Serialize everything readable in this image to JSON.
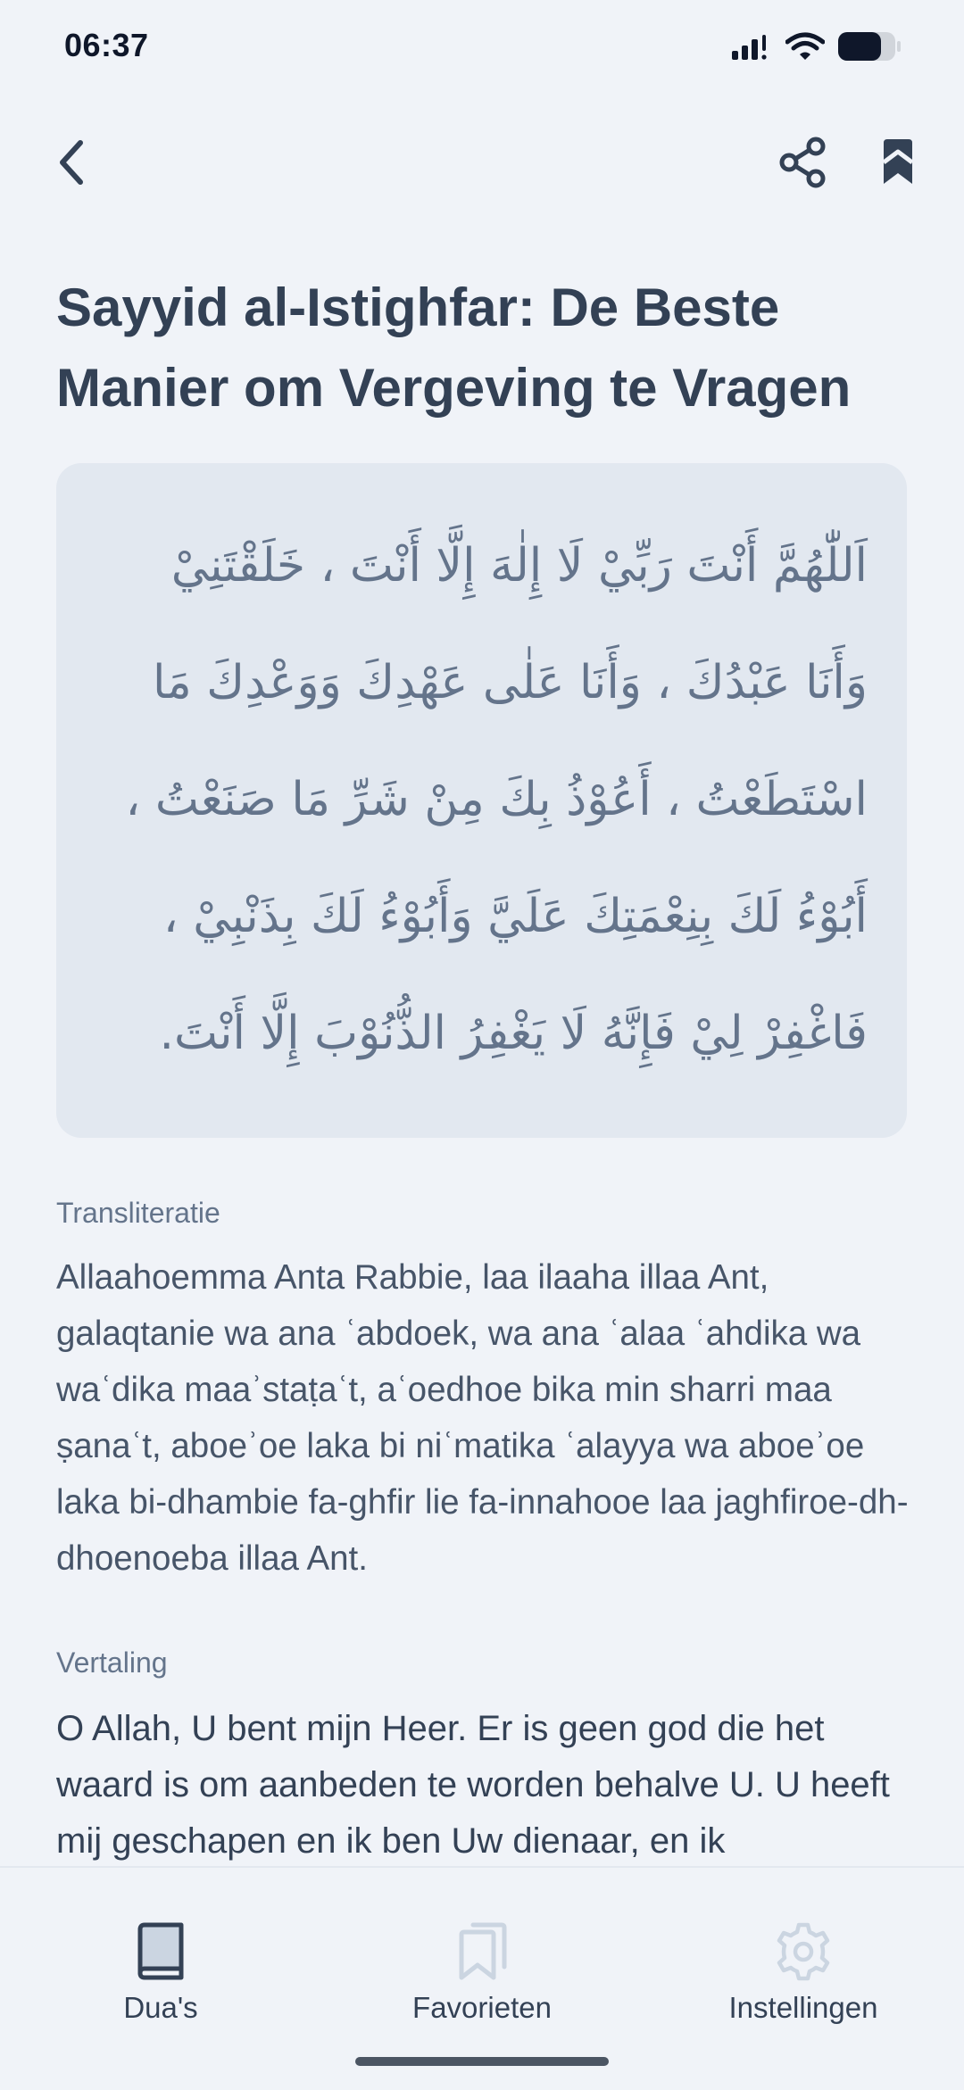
{
  "status_bar": {
    "time": "06:37"
  },
  "nav": {
    "back_icon": "chevron-left-icon",
    "share_icon": "share-icon",
    "bookmark_icon": "bookmark-icon"
  },
  "title": "Sayyid al-Istighfar: De Beste Manier om Vergeving te Vragen",
  "arabic": {
    "lines": [
      "اَللّٰهُمَّ أَنْتَ رَبِّيْ لَا إِلٰهَ إِلَّا أَنْتَ ، خَلَقْتَنِيْ",
      "وَأَنَا عَبْدُكَ ، وَأَنَا عَلٰى عَهْدِكَ وَوَعْدِكَ مَا",
      "اسْتَطَعْتُ ، أَعُوْذُ بِكَ مِنْ شَرِّ مَا صَنَعْتُ ،",
      "أَبُوْءُ لَكَ بِنِعْمَتِكَ عَلَيَّ وَأَبُوْءُ لَكَ بِذَنْبِيْ ،",
      "فَاغْفِرْ لِيْ فَإِنَّهُ لَا يَغْفِرُ الذُّنُوْبَ إِلَّا أَنْتَ."
    ]
  },
  "transliteration": {
    "label": "Transliteratie",
    "text": "Allaahoemma Anta Rabbie, laa ilaaha illaa Ant, galaqtanie wa ana ʿabdoek, wa ana ʿalaa ʿahdika wa waʿdika maaʾstaṭaʿt, aʿoedhoe bika min sharri maa ṣanaʿt, aboeʾoe laka bi niʿmatika ʿalayya wa aboeʾoe laka bi-dhambie fa-ghfir lie fa-innahooe laa jaghfiroe-dh-dhoenoeba illaa Ant."
  },
  "translation": {
    "label": "Vertaling",
    "text": "O Allah, U bent mijn Heer. Er is geen god die het waard is om aanbeden te worden behalve U. U heeft mij geschapen en ik ben Uw dienaar, en ik"
  },
  "tabs": [
    {
      "label": "Dua's",
      "icon": "book-icon",
      "active": true
    },
    {
      "label": "Favorieten",
      "icon": "bookmarks-icon",
      "active": false
    },
    {
      "label": "Instellingen",
      "icon": "gear-icon",
      "active": false
    }
  ],
  "colors": {
    "background": "#f0f3f8",
    "card": "#e2e8f0",
    "title": "#334155",
    "muted": "#64748b",
    "active_icon": "#334155",
    "inactive_icon": "#cbd5e1"
  }
}
